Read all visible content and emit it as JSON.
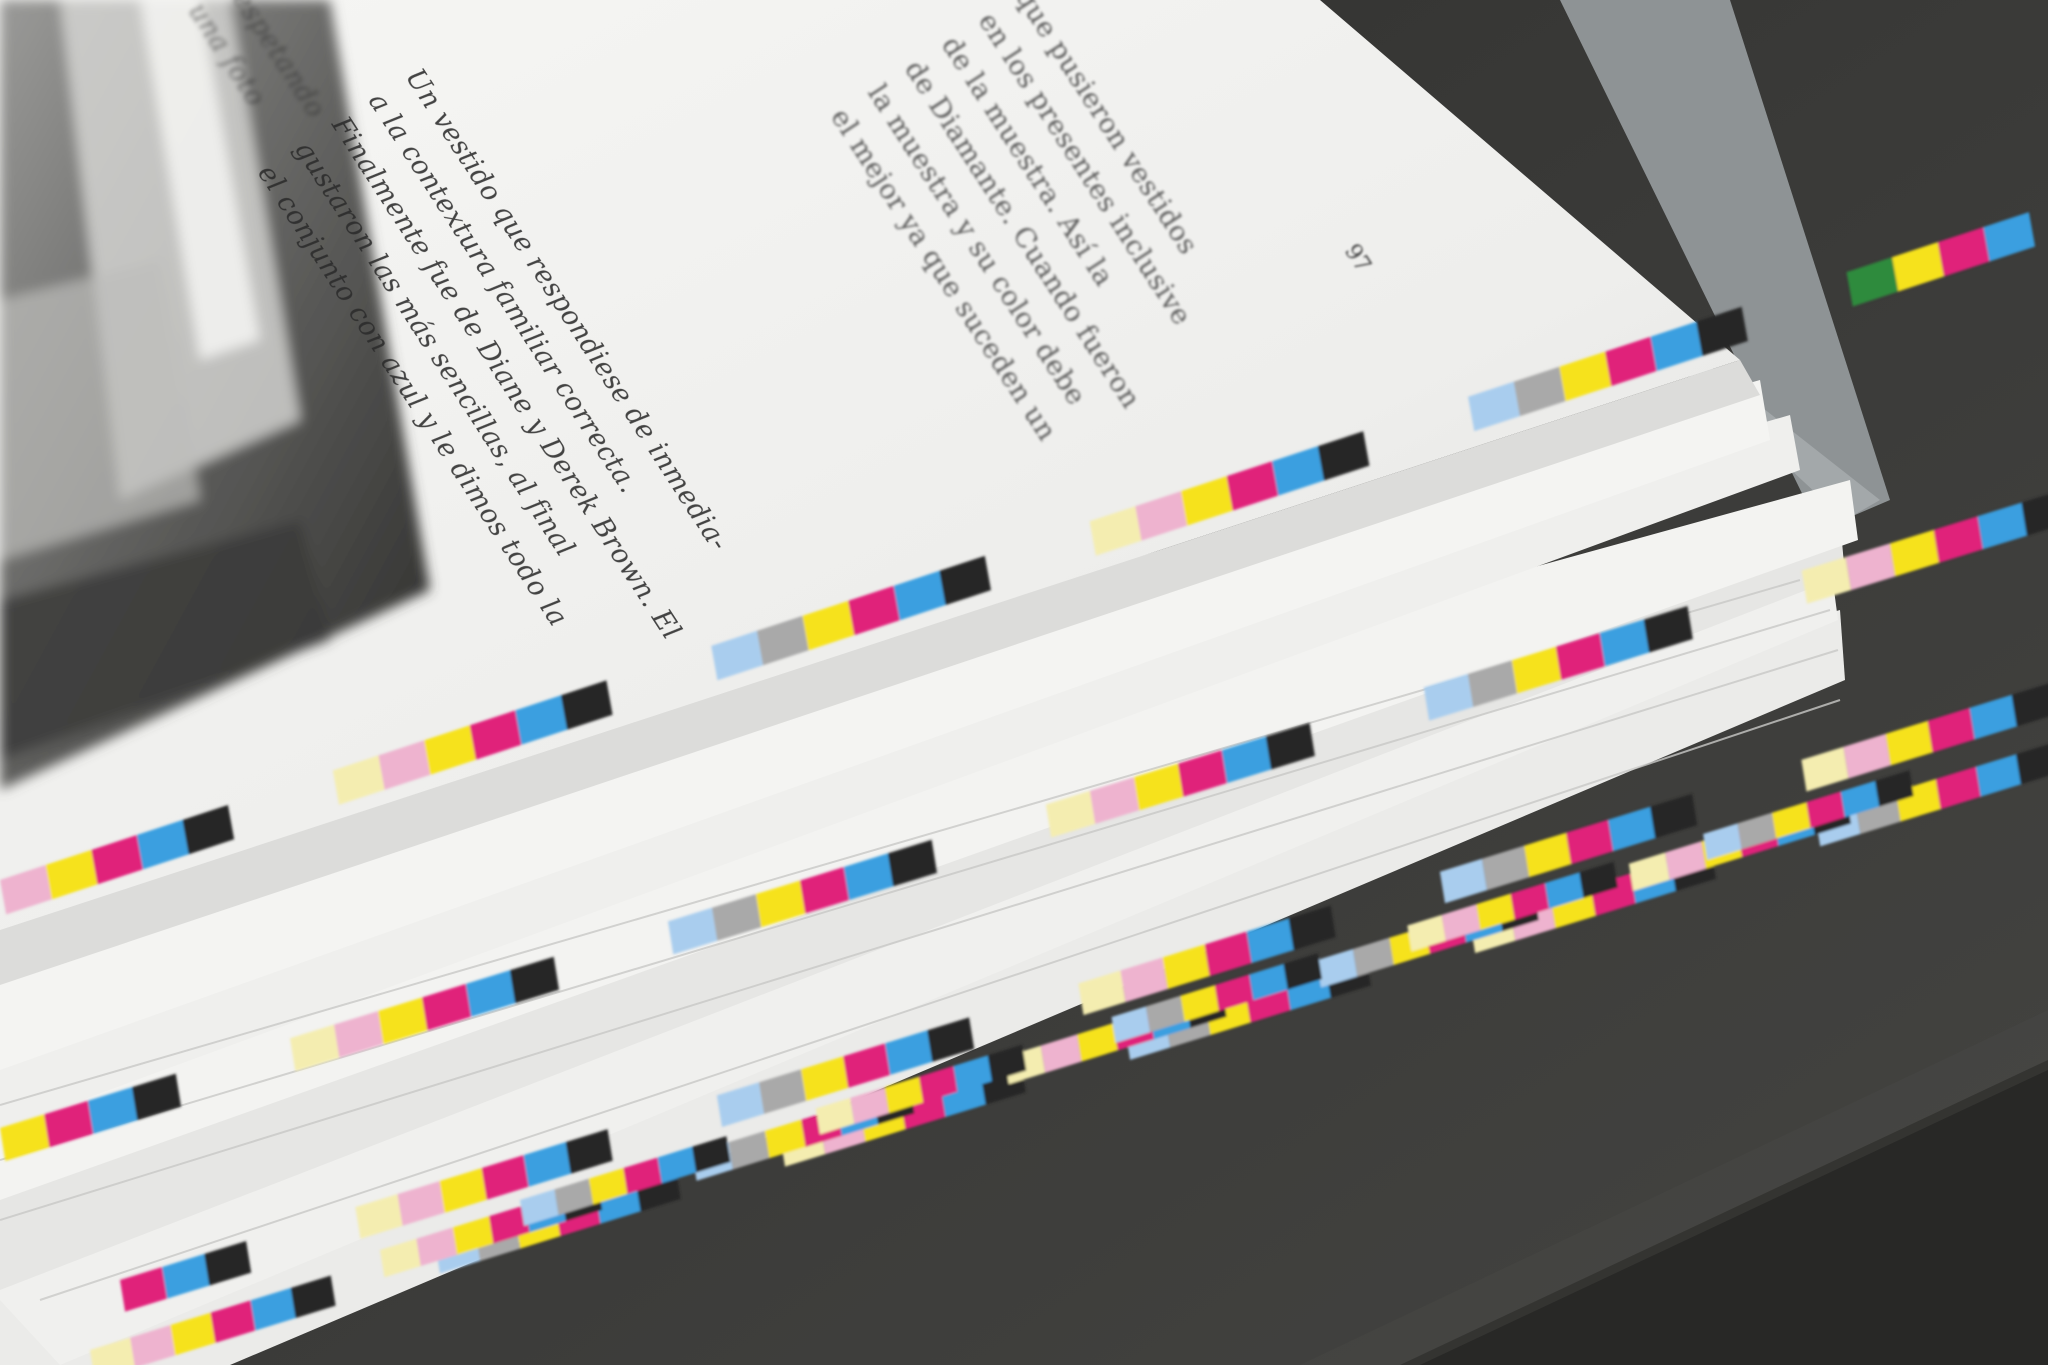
{
  "photo": {
    "subject": "printed book proof with CMYK color bars",
    "colors": {
      "background": "#3a3a38",
      "page": "#f1f1ef",
      "cyan": "#3a9fe0",
      "magenta": "#e0207a",
      "yellow": "#f6e21c",
      "black": "#262626",
      "green": "#2e8b3d",
      "light_cyan": "#a9cdee",
      "light_magenta": "#eeb3cf",
      "light_yellow": "#f4edb0",
      "gray": "#a9a9a9"
    }
  },
  "page_text": {
    "left_column": [
      "Un vestido que respondiese de inmedia-",
      "a la contextura familiar correcta.",
      "Finalmente fue de Diane y Derek Brown. El",
      "gustaron las más sencillas, al final",
      "el conjunto con azul y le dimos todo la"
    ],
    "right_column": [
      "que pusieron vestidos",
      "en los presentes inclusive",
      "de la muestra. Así la",
      "de Diamante. Cuando fueron",
      "la muestra y su color debe",
      "el mejor ya que suceden un"
    ],
    "top_column": [
      "respetando",
      "una foto"
    ],
    "folio": "97"
  }
}
